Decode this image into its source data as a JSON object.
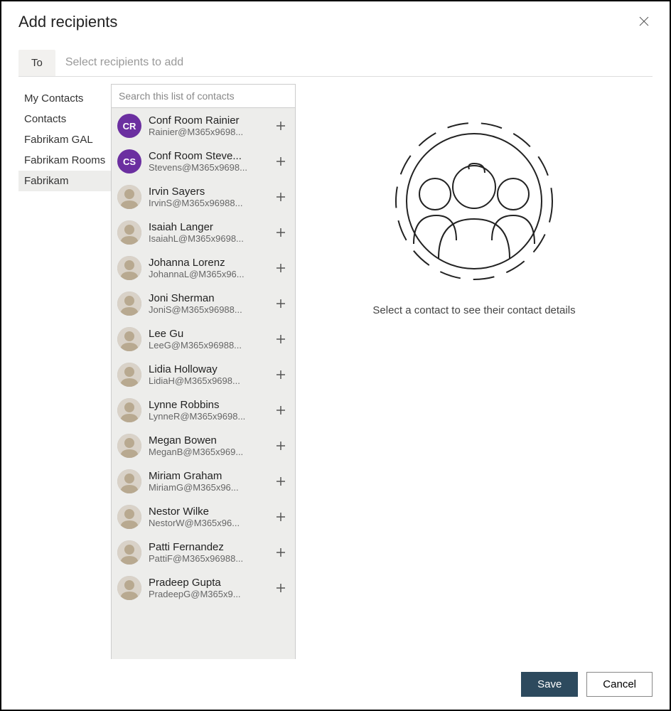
{
  "dialog": {
    "title": "Add recipients",
    "to_label": "To",
    "to_placeholder": "Select recipients to add",
    "search_placeholder": "Search this list of contacts",
    "details_placeholder": "Select a contact to see their contact details",
    "save_label": "Save",
    "cancel_label": "Cancel"
  },
  "sidebar": {
    "items": [
      {
        "label": "My Contacts",
        "selected": false
      },
      {
        "label": "Contacts",
        "selected": false
      },
      {
        "label": "Fabrikam GAL",
        "selected": false
      },
      {
        "label": "Fabrikam Rooms",
        "selected": false
      },
      {
        "label": "Fabrikam",
        "selected": true
      }
    ]
  },
  "contacts": [
    {
      "name": "Conf Room Rainier",
      "email": "Rainier@M365x9698...",
      "initials": "CR",
      "avatar_color": "#6b2fa0",
      "type": "initials"
    },
    {
      "name": "Conf Room Steve...",
      "email": "Stevens@M365x9698...",
      "initials": "CS",
      "avatar_color": "#6b2fa0",
      "type": "initials"
    },
    {
      "name": "Irvin Sayers",
      "email": "IrvinS@M365x96988...",
      "type": "photo"
    },
    {
      "name": "Isaiah Langer",
      "email": "IsaiahL@M365x9698...",
      "type": "photo"
    },
    {
      "name": "Johanna Lorenz",
      "email": "JohannaL@M365x96...",
      "type": "photo"
    },
    {
      "name": "Joni Sherman",
      "email": "JoniS@M365x96988...",
      "type": "photo"
    },
    {
      "name": "Lee Gu",
      "email": "LeeG@M365x96988...",
      "type": "photo"
    },
    {
      "name": "Lidia Holloway",
      "email": "LidiaH@M365x9698...",
      "type": "photo"
    },
    {
      "name": "Lynne Robbins",
      "email": "LynneR@M365x9698...",
      "type": "photo"
    },
    {
      "name": "Megan Bowen",
      "email": "MeganB@M365x969...",
      "type": "photo"
    },
    {
      "name": "Miriam Graham",
      "email": "MiriamG@M365x96...",
      "type": "photo"
    },
    {
      "name": "Nestor Wilke",
      "email": "NestorW@M365x96...",
      "type": "photo"
    },
    {
      "name": "Patti Fernandez",
      "email": "PattiF@M365x96988...",
      "type": "photo"
    },
    {
      "name": "Pradeep Gupta",
      "email": "PradeepG@M365x9...",
      "type": "photo"
    }
  ]
}
